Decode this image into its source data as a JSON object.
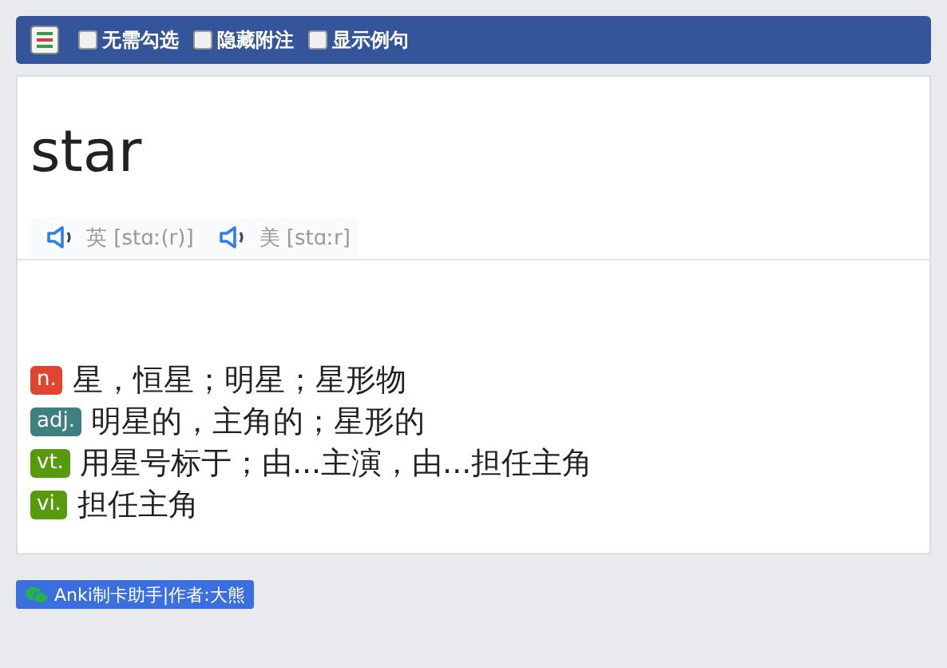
{
  "toolbar": {
    "options": [
      {
        "label": "无需勾选",
        "checked": false
      },
      {
        "label": "隐藏附注",
        "checked": false
      },
      {
        "label": "显示例句",
        "checked": false
      }
    ]
  },
  "word": "star",
  "pronunciations": [
    {
      "region": "英",
      "phonetic": "[stɑː(r)]"
    },
    {
      "region": "美",
      "phonetic": "[stɑːr]"
    }
  ],
  "definitions": [
    {
      "pos": "n.",
      "color": "#e0462f",
      "meaning": "星，恒星；明星；星形物"
    },
    {
      "pos": "adj.",
      "color": "#3f7f7f",
      "meaning": "明星的，主角的；星形的"
    },
    {
      "pos": "vt.",
      "color": "#589a0e",
      "meaning": "用星号标于；由...主演，由...担任主角"
    },
    {
      "pos": "vi.",
      "color": "#589a0e",
      "meaning": "担任主角"
    }
  ],
  "footer": {
    "label": "Anki制卡助手|作者:大熊"
  }
}
